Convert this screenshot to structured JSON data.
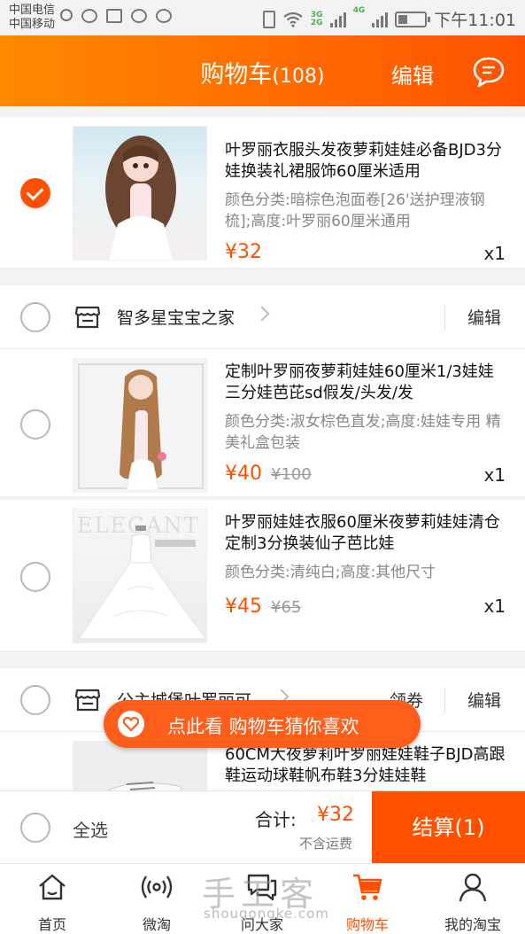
{
  "status_bar": {
    "carrier1": "中国电信",
    "carrier2": "中国移动",
    "net1": "3G",
    "net2": "2G",
    "net3": "4G",
    "time": "下午11:01"
  },
  "header": {
    "title": "购物车",
    "count": "(108)",
    "edit": "编辑",
    "icon": "message-icon"
  },
  "items": [
    {
      "name": "叶罗丽衣服头发夜萝莉娃娃必备BJD3分娃换装礼裙服饰60厘米适用",
      "spec": "颜色分类:暗棕色泡面卷[26'送护理液钢梳];高度:叶罗丽60厘米通用",
      "price": "¥32",
      "original_price": "",
      "qty": "x1",
      "checked": true
    }
  ],
  "shops": [
    {
      "name": "智多星宝宝之家",
      "coupon": "",
      "edit": "编辑",
      "items": [
        {
          "name": "定制叶罗丽夜萝莉娃娃60厘米1/3娃娃三分娃芭芘sd假发/头发/发",
          "spec": "颜色分类:淑女棕色直发;高度:娃娃专用 精美礼盒包装",
          "price": "¥40",
          "original_price": "¥100",
          "qty": "x1"
        },
        {
          "name": "叶罗丽娃娃衣服60厘米夜萝莉娃娃清仓定制3分换装仙子芭比娃",
          "spec": "颜色分类:清纯白;高度:其他尺寸",
          "price": "¥45",
          "original_price": "¥65",
          "qty": "x1"
        }
      ]
    },
    {
      "name": "公主城堡叶罗丽可",
      "coupon": "领券",
      "edit": "编辑",
      "items": [
        {
          "name": "60CM大夜萝莉叶罗丽娃娃鞋子BJD高跟鞋运动球鞋帆布鞋3分娃娃鞋"
        }
      ]
    }
  ],
  "promo_pill": {
    "text": "点此看 购物车猜你喜欢"
  },
  "checkout": {
    "select_all": "全选",
    "total_label": "合计:",
    "total_value": "¥32",
    "freight_note": "不含运费",
    "button": "结算(1)"
  },
  "tabs": [
    {
      "label": "首页",
      "icon": "home-icon"
    },
    {
      "label": "微淘",
      "icon": "broadcast-icon"
    },
    {
      "label": "问大家",
      "icon": "chat-icon"
    },
    {
      "label": "购物车",
      "icon": "cart-icon",
      "active": true
    },
    {
      "label": "我的淘宝",
      "icon": "profile-icon"
    }
  ],
  "watermark": {
    "text": "手工客",
    "url": "shougongke.com"
  },
  "colors": {
    "accent": "#ff5000",
    "header_start": "#ff8a00",
    "header_end": "#ff5200"
  }
}
